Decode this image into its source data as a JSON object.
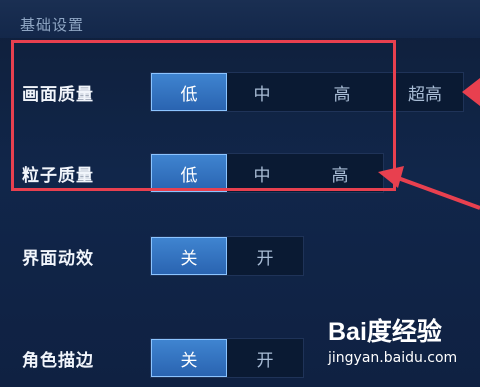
{
  "section_title": "基础设置",
  "settings": [
    {
      "label": "画面质量",
      "options": [
        "低",
        "中",
        "高",
        "超高"
      ],
      "selected": "低"
    },
    {
      "label": "粒子质量",
      "options": [
        "低",
        "中",
        "高"
      ],
      "selected": "低"
    },
    {
      "label": "界面动效",
      "options": [
        "关",
        "开"
      ],
      "selected": "关"
    },
    {
      "label": "角色描边",
      "options": [
        "关",
        "开"
      ],
      "selected": "关"
    }
  ],
  "watermark": {
    "brand": "Bai度经验",
    "url": "jingyan.baidu.com"
  },
  "colors": {
    "highlight": "#e8404f",
    "active_option": "#3f84d0",
    "background": "#0f1f3a"
  }
}
